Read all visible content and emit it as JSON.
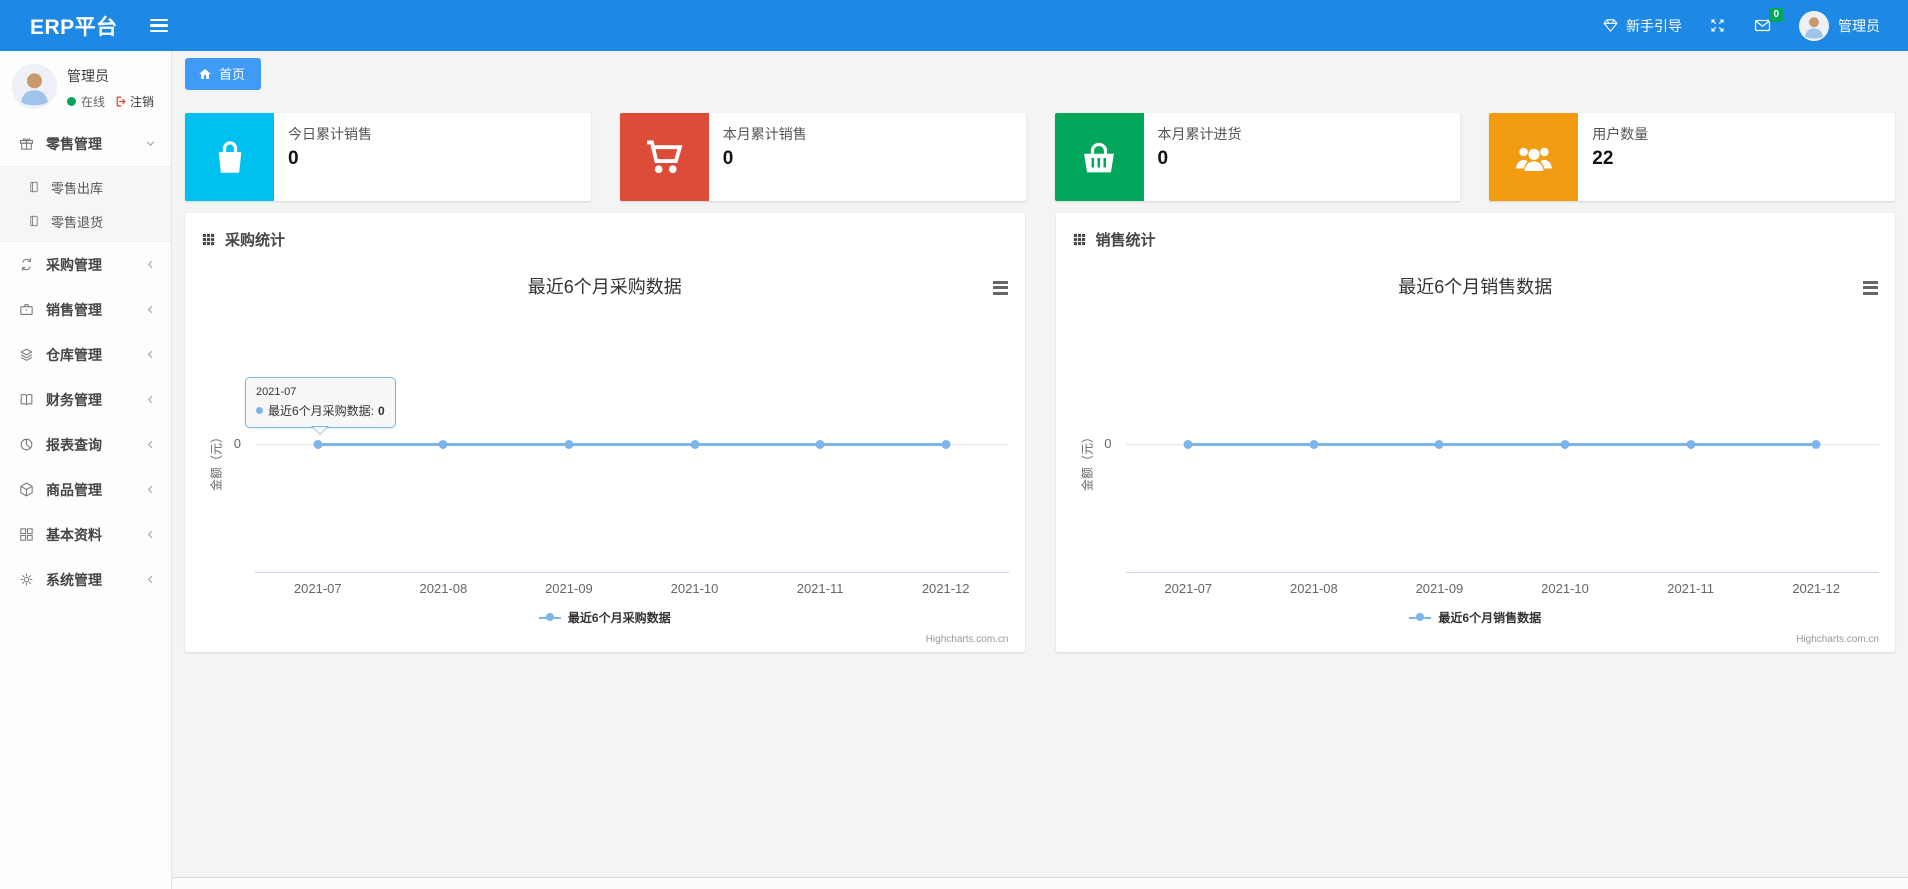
{
  "theme": {
    "navbar_bg": "#1e88e5",
    "tab_bg": "#3f9bf5",
    "badge_bg": "#00a65a"
  },
  "navbar": {
    "brand": "ERP平台",
    "guide": "新手引导",
    "badge": "0",
    "user": "管理员"
  },
  "sidebar": {
    "user": {
      "name": "管理员",
      "status": "在线",
      "logout": "注销"
    },
    "items": [
      {
        "label": "零售管理",
        "icon": "gift-icon"
      },
      {
        "label": "零售出库",
        "icon": "file-icon"
      },
      {
        "label": "零售退货",
        "icon": "file-icon"
      },
      {
        "label": "采购管理",
        "icon": "loop-icon"
      },
      {
        "label": "销售管理",
        "icon": "briefcase-icon"
      },
      {
        "label": "仓库管理",
        "icon": "layers-icon"
      },
      {
        "label": "财务管理",
        "icon": "book-icon"
      },
      {
        "label": "报表查询",
        "icon": "pie-chart-icon"
      },
      {
        "label": "商品管理",
        "icon": "box-icon"
      },
      {
        "label": "基本资料",
        "icon": "grid-icon"
      },
      {
        "label": "系统管理",
        "icon": "gear-icon"
      }
    ]
  },
  "breadcrumb": {
    "home": "首页"
  },
  "stat_cards": [
    {
      "label": "今日累计销售",
      "value": "0",
      "color": "#00c0ef",
      "icon": "shopping-bag-icon"
    },
    {
      "label": "本月累计销售",
      "value": "0",
      "color": "#dd4b39",
      "icon": "shopping-cart-icon"
    },
    {
      "label": "本月累计进货",
      "value": "0",
      "color": "#00a65a",
      "icon": "shopping-basket-icon"
    },
    {
      "label": "用户数量",
      "value": "22",
      "color": "#f39c12",
      "icon": "users-icon"
    }
  ],
  "panels": [
    {
      "title": "采购统计"
    },
    {
      "title": "销售统计"
    }
  ],
  "chart_data": [
    {
      "type": "line",
      "title": "最近6个月采购数据",
      "categories": [
        "2021-07",
        "2021-08",
        "2021-09",
        "2021-10",
        "2021-11",
        "2021-12"
      ],
      "series": [
        {
          "name": "最近6个月采购数据",
          "values": [
            0,
            0,
            0,
            0,
            0,
            0
          ]
        }
      ],
      "ylabel": "金额（元）",
      "yticks": [
        "0"
      ],
      "legend_position": "bottom",
      "grid": "off",
      "line_color": "#7cb5ec",
      "credits": "Highcharts.com.cn",
      "tooltip": {
        "header": "2021-07",
        "label": "最近6个月采购数据:",
        "value": "0"
      }
    },
    {
      "type": "line",
      "title": "最近6个月销售数据",
      "categories": [
        "2021-07",
        "2021-08",
        "2021-09",
        "2021-10",
        "2021-11",
        "2021-12"
      ],
      "series": [
        {
          "name": "最近6个月销售数据",
          "values": [
            0,
            0,
            0,
            0,
            0,
            0
          ]
        }
      ],
      "ylabel": "金额（元）",
      "yticks": [
        "0"
      ],
      "legend_position": "bottom",
      "grid": "off",
      "line_color": "#7cb5ec",
      "credits": "Highcharts.com.cn"
    }
  ]
}
